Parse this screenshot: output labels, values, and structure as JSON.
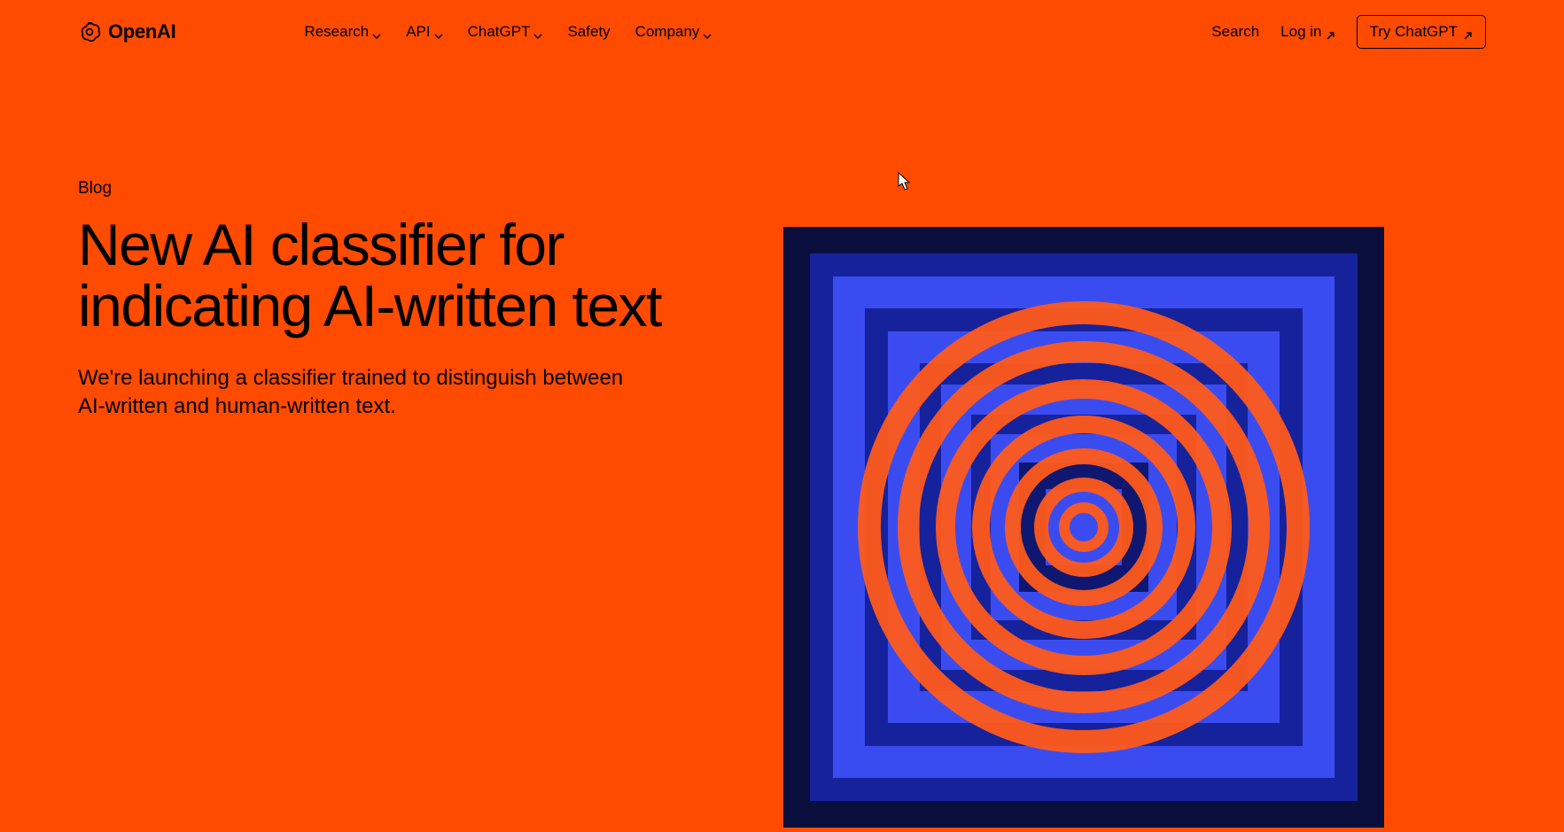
{
  "brand": {
    "name": "OpenAI"
  },
  "nav": {
    "primary": [
      {
        "label": "Research",
        "has_dropdown": true
      },
      {
        "label": "API",
        "has_dropdown": true
      },
      {
        "label": "ChatGPT",
        "has_dropdown": true
      },
      {
        "label": "Safety",
        "has_dropdown": false
      },
      {
        "label": "Company",
        "has_dropdown": true
      }
    ],
    "search_label": "Search",
    "login_label": "Log in",
    "cta_label": "Try ChatGPT"
  },
  "article": {
    "category": "Blog",
    "title": "New AI classifier for indicating AI-written text",
    "subtitle": "We're launching a classifier trained to distinguish between AI-written and human-written text."
  },
  "colors": {
    "background": "#ff4b00",
    "art_dark_blue": "#0a0e3d",
    "art_blue": "#2432d8",
    "art_orange": "#ff5a1a"
  }
}
